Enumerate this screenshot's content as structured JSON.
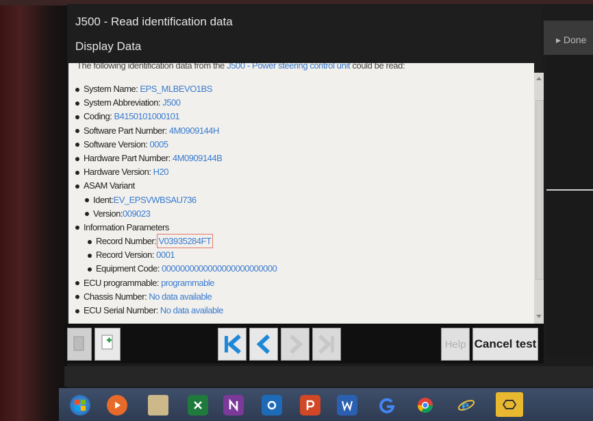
{
  "header": {
    "title": "J500 - Read identification data",
    "subtitle": "Display Data"
  },
  "side": {
    "done_label": "▸ Done"
  },
  "intro": {
    "prefix": "The following identification data from the",
    "link": "J500 - Power steering control unit",
    "suffix": "could be read:"
  },
  "params": {
    "system_name": {
      "label": "System Name:",
      "value": "EPS_MLBEVO1BS"
    },
    "system_abbreviation": {
      "label": "System Abbreviation:",
      "value": "J500"
    },
    "coding": {
      "label": "Coding:",
      "value": "B4150101000101"
    },
    "software_part_number": {
      "label": "Software Part Number:",
      "value": "4M0909144H"
    },
    "software_version": {
      "label": "Software Version:",
      "value": "0005"
    },
    "hardware_part_number": {
      "label": "Hardware Part Number:",
      "value": "4M0909144B"
    },
    "hardware_version": {
      "label": "Hardware Version:",
      "value": "H20"
    },
    "asam_variant": {
      "label": "ASAM Variant"
    },
    "asam_ident": {
      "label": "Ident:",
      "value": "EV_EPSVWBSAU736"
    },
    "asam_version": {
      "label": "Version:",
      "value": "009023"
    },
    "information_parameters": {
      "label": "Information Parameters"
    },
    "record_number": {
      "label": "Record Number:",
      "value": "V03935284FT"
    },
    "record_version": {
      "label": "Record Version:",
      "value": "0001"
    },
    "equipment_code": {
      "label": "Equipment Code:",
      "value": "0000000000000000000000000"
    },
    "ecu_programmable": {
      "label": "ECU programmable:",
      "value": "programmable"
    },
    "chassis_number": {
      "label": "Chassis Number:",
      "value": "No data available"
    },
    "ecu_serial_number": {
      "label": "ECU Serial Number:",
      "value": "No data available"
    }
  },
  "toolbar": {
    "help_label": "Help",
    "cancel_label": "Cancel test"
  },
  "taskbar": {
    "icons": [
      "start-icon",
      "media-player-icon",
      "file-explorer-icon",
      "excel-icon",
      "onenote-icon",
      "outlook-icon",
      "powerpoint-icon",
      "word-icon",
      "google-icon",
      "chrome-icon",
      "internet-explorer-icon",
      "odis-app-icon"
    ]
  }
}
